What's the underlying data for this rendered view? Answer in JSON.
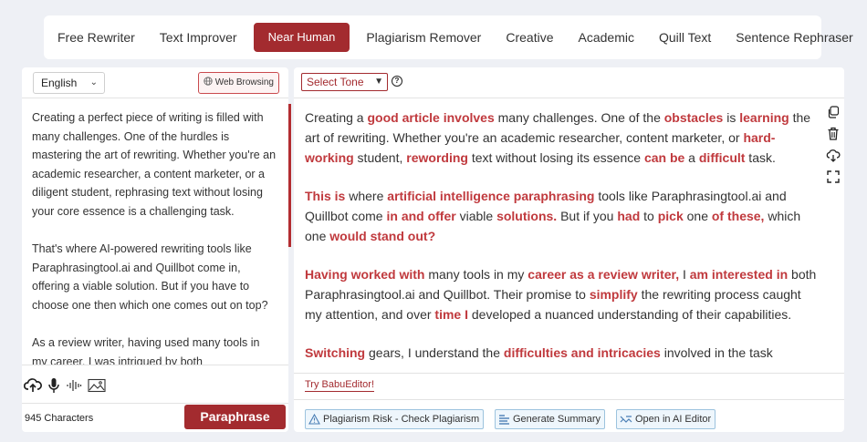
{
  "modes": [
    {
      "label": "Free Rewriter",
      "active": false
    },
    {
      "label": "Text Improver",
      "active": false
    },
    {
      "label": "Near Human",
      "active": true
    },
    {
      "label": "Plagiarism Remover",
      "active": false
    },
    {
      "label": "Creative",
      "active": false
    },
    {
      "label": "Academic",
      "active": false
    },
    {
      "label": "Quill Text",
      "active": false
    },
    {
      "label": "Sentence Rephraser",
      "active": false
    }
  ],
  "left": {
    "language": "English",
    "web_browsing_label": "Web Browsing",
    "paragraphs": [
      "Creating a perfect piece of writing is filled with many challenges. One of the hurdles is mastering the art of rewriting. Whether you're an academic researcher, a content marketer, or a diligent student, rephrasing text without losing your core essence is a challenging task.",
      "That's where AI-powered rewriting tools like Paraphrasingtool.ai and Quillbot come in, offering a viable solution. But if you have to choose one then which one comes out on top?",
      "As a review writer, having used many tools in my career, I was intrigued by both"
    ],
    "char_count": "945 Characters",
    "paraphrase_label": "Paraphrase"
  },
  "right": {
    "tone_label": "Select Tone",
    "help_glyph": "?",
    "paragraphs": [
      [
        {
          "t": "Creating a ",
          "h": false
        },
        {
          "t": "good article involves",
          "h": true
        },
        {
          "t": " many challenges. One of the ",
          "h": false
        },
        {
          "t": "obstacles",
          "h": true
        },
        {
          "t": " is ",
          "h": false
        },
        {
          "t": "learning",
          "h": true
        },
        {
          "t": " the art of rewriting. Whether you're an academic researcher, content marketer, or ",
          "h": false
        },
        {
          "t": "hard-working",
          "h": true
        },
        {
          "t": " student, ",
          "h": false
        },
        {
          "t": "rewording",
          "h": true
        },
        {
          "t": " text without losing its essence ",
          "h": false
        },
        {
          "t": "can be",
          "h": true
        },
        {
          "t": " a ",
          "h": false
        },
        {
          "t": "difficult",
          "h": true
        },
        {
          "t": " task.",
          "h": false
        }
      ],
      [
        {
          "t": "This is",
          "h": true
        },
        {
          "t": " where ",
          "h": false
        },
        {
          "t": "artificial intelligence paraphrasing",
          "h": true
        },
        {
          "t": " tools like Paraphrasingtool.ai and Quillbot come ",
          "h": false
        },
        {
          "t": "in and offer",
          "h": true
        },
        {
          "t": " viable ",
          "h": false
        },
        {
          "t": "solutions.",
          "h": true
        },
        {
          "t": " But if you ",
          "h": false
        },
        {
          "t": "had",
          "h": true
        },
        {
          "t": " to ",
          "h": false
        },
        {
          "t": "pick",
          "h": true
        },
        {
          "t": " one ",
          "h": false
        },
        {
          "t": "of these,",
          "h": true
        },
        {
          "t": " which one ",
          "h": false
        },
        {
          "t": "would stand out?",
          "h": true
        }
      ],
      [
        {
          "t": "Having worked with",
          "h": true
        },
        {
          "t": " many tools in my ",
          "h": false
        },
        {
          "t": "career as a review writer,",
          "h": true
        },
        {
          "t": " I ",
          "h": false
        },
        {
          "t": "am interested in",
          "h": true
        },
        {
          "t": " both Paraphrasingtool.ai and Quillbot. Their promise to ",
          "h": false
        },
        {
          "t": "simplify",
          "h": true
        },
        {
          "t": " the rewriting process caught my attention, and over ",
          "h": false
        },
        {
          "t": "time I",
          "h": true
        },
        {
          "t": " developed a nuanced understanding of their capabilities.",
          "h": false
        }
      ],
      [
        {
          "t": "Switching",
          "h": true
        },
        {
          "t": " gears, I understand the ",
          "h": false
        },
        {
          "t": "difficulties and intricacies",
          "h": true
        },
        {
          "t": " involved in the task",
          "h": false
        }
      ]
    ],
    "try_link": "Try BabuEditor!",
    "actions": {
      "plagiarism": "Plagiarism Risk - Check Plagiarism",
      "summary": "Generate Summary",
      "ai_editor": "Open in AI Editor"
    }
  },
  "colors": {
    "brand": "#a32b2f",
    "highlight": "#c0393d",
    "action_border": "#9cc3de"
  }
}
